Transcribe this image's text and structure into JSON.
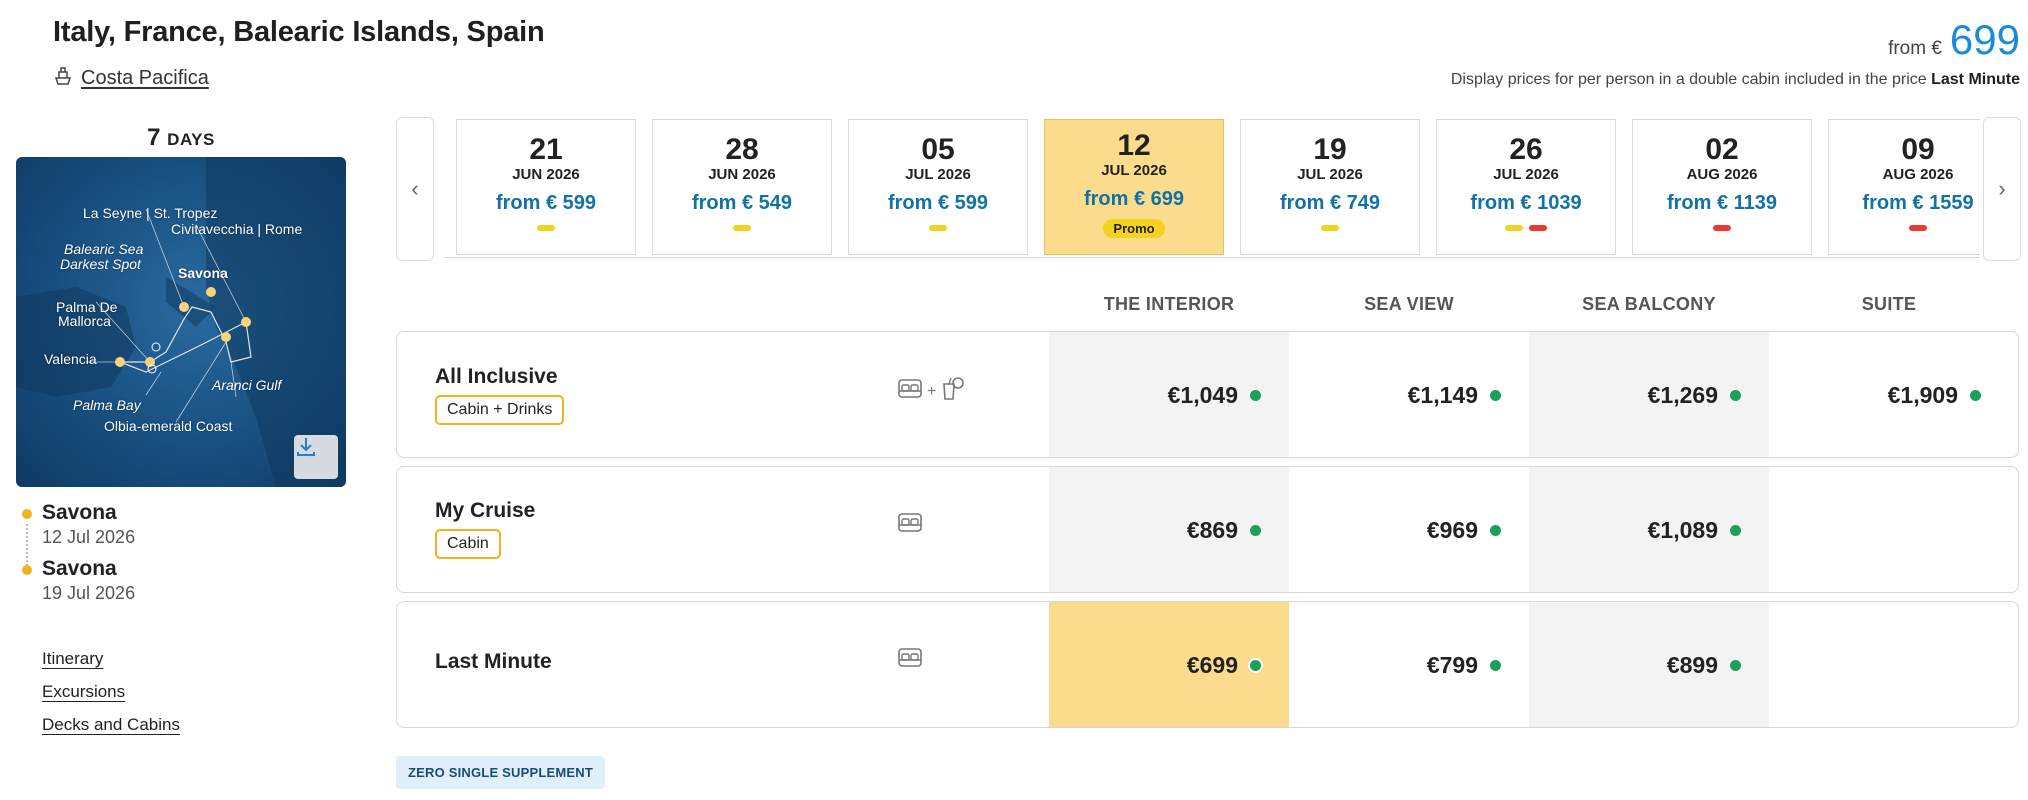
{
  "header": {
    "title": "Italy, France, Balearic Islands, Spain",
    "ship_name": "Costa Pacifica",
    "from_label": "from €",
    "from_price": "699",
    "disclaimer_prefix": "Display prices for per person in a double cabin included in the price",
    "disclaimer_bold": "Last Minute"
  },
  "duration": {
    "number": "7",
    "unit": "DAYS"
  },
  "map": {
    "labels": {
      "la_seyne": "La Seyne | St. Tropez",
      "civitavecchia": "Civitavecchia | Rome",
      "balearic": "Balearic Sea",
      "darkest": "Darkest Spot",
      "savona": "Savona",
      "palma_de": "Palma De",
      "mallorca": "Mallorca",
      "valencia": "Valencia",
      "aranci": "Aranci Gulf",
      "palma_bay": "Palma Bay",
      "olbia": "Olbia-emerald Coast"
    },
    "download_icon": "download-icon"
  },
  "itinerary_stops": [
    {
      "port": "Savona",
      "date": "12 Jul 2026"
    },
    {
      "port": "Savona",
      "date": "19 Jul 2026"
    }
  ],
  "links": [
    "Itinerary",
    "Excursions",
    "Decks and Cabins"
  ],
  "carousel": {
    "prev_icon": "chevron-left-icon",
    "next_icon": "chevron-right-icon",
    "dates": [
      {
        "day": "21",
        "month": "JUN 2026",
        "price": "from € 599",
        "marks": [
          "y"
        ]
      },
      {
        "day": "28",
        "month": "JUN 2026",
        "price": "from € 549",
        "marks": [
          "y"
        ]
      },
      {
        "day": "05",
        "month": "JUL 2026",
        "price": "from € 599",
        "marks": [
          "y"
        ]
      },
      {
        "day": "12",
        "month": "JUL 2026",
        "price": "from € 699",
        "promo": "Promo",
        "selected": true
      },
      {
        "day": "19",
        "month": "JUL 2026",
        "price": "from € 749",
        "marks": [
          "y"
        ]
      },
      {
        "day": "26",
        "month": "JUL 2026",
        "price": "from € 1039",
        "marks": [
          "y",
          "r"
        ]
      },
      {
        "day": "02",
        "month": "AUG 2026",
        "price": "from € 1139",
        "marks": [
          "r"
        ]
      },
      {
        "day": "09",
        "month": "AUG 2026",
        "price": "from € 1559",
        "marks": [
          "r"
        ]
      }
    ]
  },
  "cabin_columns": [
    "THE INTERIOR",
    "SEA VIEW",
    "SEA BALCONY",
    "SUITE"
  ],
  "fares": [
    {
      "name": "All Inclusive",
      "tag": "Cabin + Drinks",
      "icons": [
        "bed-icon",
        "drink-icon"
      ],
      "plus": "+",
      "prices": [
        "€1,049",
        "€1,149",
        "€1,269",
        "€1,909"
      ]
    },
    {
      "name": "My Cruise",
      "tag": "Cabin",
      "icons": [
        "bed-icon"
      ],
      "prices": [
        "€869",
        "€969",
        "€1,089",
        ""
      ]
    },
    {
      "name": "Last Minute",
      "tag": "",
      "icons": [
        "bed-icon"
      ],
      "prices": [
        "€699",
        "€799",
        "€899",
        ""
      ]
    }
  ],
  "badge": "ZERO SINGLE SUPPLEMENT",
  "colors": {
    "accent_blue": "#1a8bd8",
    "price_blue": "#1172a6",
    "highlight": "#fbdb8c",
    "promo_yellow": "#f5d21f",
    "available_green": "#1aa05a",
    "unavailable_red": "#ea3a32"
  }
}
